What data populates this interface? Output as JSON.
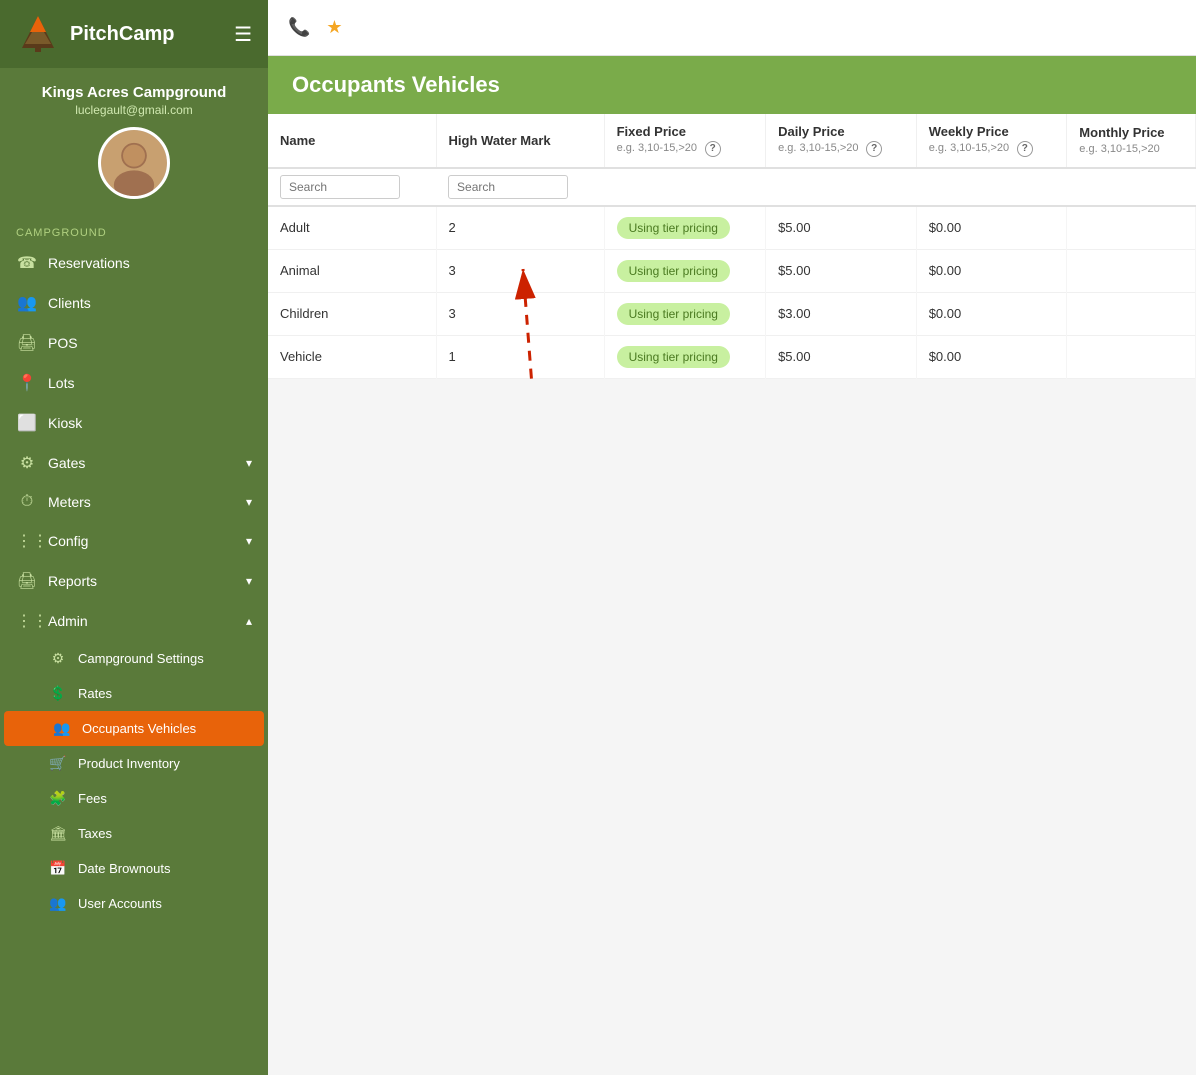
{
  "app": {
    "title": "PitchCamp"
  },
  "user": {
    "name": "Kings Acres Campground",
    "email": "luclegault@gmail.com"
  },
  "sidebar": {
    "section_label": "CAMPGROUND",
    "items": [
      {
        "id": "reservations",
        "label": "Reservations",
        "icon": "📞",
        "has_children": false
      },
      {
        "id": "clients",
        "label": "Clients",
        "icon": "👥",
        "has_children": false
      },
      {
        "id": "pos",
        "label": "POS",
        "icon": "🖨",
        "has_children": false
      },
      {
        "id": "lots",
        "label": "Lots",
        "icon": "📍",
        "has_children": false
      },
      {
        "id": "kiosk",
        "label": "Kiosk",
        "icon": "⬜",
        "has_children": false
      },
      {
        "id": "gates",
        "label": "Gates",
        "icon": "⚙",
        "has_children": true
      },
      {
        "id": "meters",
        "label": "Meters",
        "icon": "🕐",
        "has_children": true
      },
      {
        "id": "config",
        "label": "Config",
        "icon": "⋮⋮",
        "has_children": true
      },
      {
        "id": "reports",
        "label": "Reports",
        "icon": "🖨",
        "has_children": true
      },
      {
        "id": "admin",
        "label": "Admin",
        "icon": "⋮⋮",
        "has_children": true,
        "expanded": true
      }
    ],
    "admin_sub_items": [
      {
        "id": "campground-settings",
        "label": "Campground Settings",
        "icon": "⚙",
        "active": false
      },
      {
        "id": "rates",
        "label": "Rates",
        "icon": "💲",
        "active": false
      },
      {
        "id": "occupants-vehicles",
        "label": "Occupants Vehicles",
        "icon": "👥",
        "active": true
      },
      {
        "id": "product-inventory",
        "label": "Product Inventory",
        "icon": "🛒",
        "active": false
      },
      {
        "id": "fees",
        "label": "Fees",
        "icon": "🧩",
        "active": false
      },
      {
        "id": "taxes",
        "label": "Taxes",
        "icon": "🏛",
        "active": false
      },
      {
        "id": "date-brownouts",
        "label": "Date Brownouts",
        "icon": "📅",
        "active": false
      },
      {
        "id": "user-accounts",
        "label": "User Accounts",
        "icon": "👥",
        "active": false
      }
    ]
  },
  "page": {
    "title": "Occupants Vehicles"
  },
  "table": {
    "columns": [
      {
        "key": "name",
        "label": "Name",
        "search": true,
        "search_placeholder": "Search"
      },
      {
        "key": "high_water_mark",
        "label": "High Water Mark",
        "search": true,
        "search_placeholder": "Search"
      },
      {
        "key": "fixed_price",
        "label": "Fixed Price",
        "hint": "e.g. 3,10-15,>20",
        "has_help": true
      },
      {
        "key": "daily_price",
        "label": "Daily Price",
        "hint": "e.g. 3,10-15,>20",
        "has_help": true
      },
      {
        "key": "weekly_price",
        "label": "Weekly Price",
        "hint": "e.g. 3,10-15,>20",
        "has_help": true
      },
      {
        "key": "monthly_price",
        "label": "Monthly Price",
        "hint": "e.g. 3,10-15,>20"
      }
    ],
    "rows": [
      {
        "name": "Adult",
        "high_water_mark": "2",
        "fixed_price": "Using tier pricing",
        "daily_price": "$5.00",
        "weekly_price": "$0.00",
        "monthly_price": ""
      },
      {
        "name": "Animal",
        "high_water_mark": "3",
        "fixed_price": "Using tier pricing",
        "daily_price": "$5.00",
        "weekly_price": "$0.00",
        "monthly_price": ""
      },
      {
        "name": "Children",
        "high_water_mark": "3",
        "fixed_price": "Using tier pricing",
        "daily_price": "$3.00",
        "weekly_price": "$0.00",
        "monthly_price": ""
      },
      {
        "name": "Vehicle",
        "high_water_mark": "1",
        "fixed_price": "Using tier pricing",
        "daily_price": "$5.00",
        "weekly_price": "$0.00",
        "monthly_price": ""
      }
    ]
  },
  "topbar": {
    "phone_icon": "📞",
    "star_icon": "★"
  }
}
